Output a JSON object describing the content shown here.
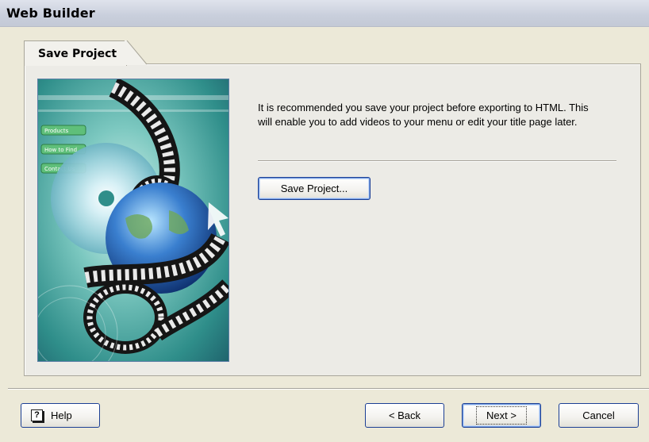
{
  "window": {
    "title": "Web Builder"
  },
  "tab": {
    "label": "Save Project"
  },
  "main": {
    "description": "It is recommended you save your project before exporting to HTML. This will enable you to add videos to your menu or edit your title page later.",
    "save_button_label": "Save Project..."
  },
  "footer": {
    "help_label": "Help",
    "help_icon_glyph": "?",
    "back_label": "< Back",
    "next_label": "Next >",
    "cancel_label": "Cancel"
  },
  "artwork": {
    "menu_items": [
      "Products",
      "How to Find",
      "Contact Us"
    ]
  },
  "colors": {
    "dialog_bg": "#ece9d8",
    "button_border": "#1c3f94",
    "artwork_bg": "#2f8e8a"
  }
}
